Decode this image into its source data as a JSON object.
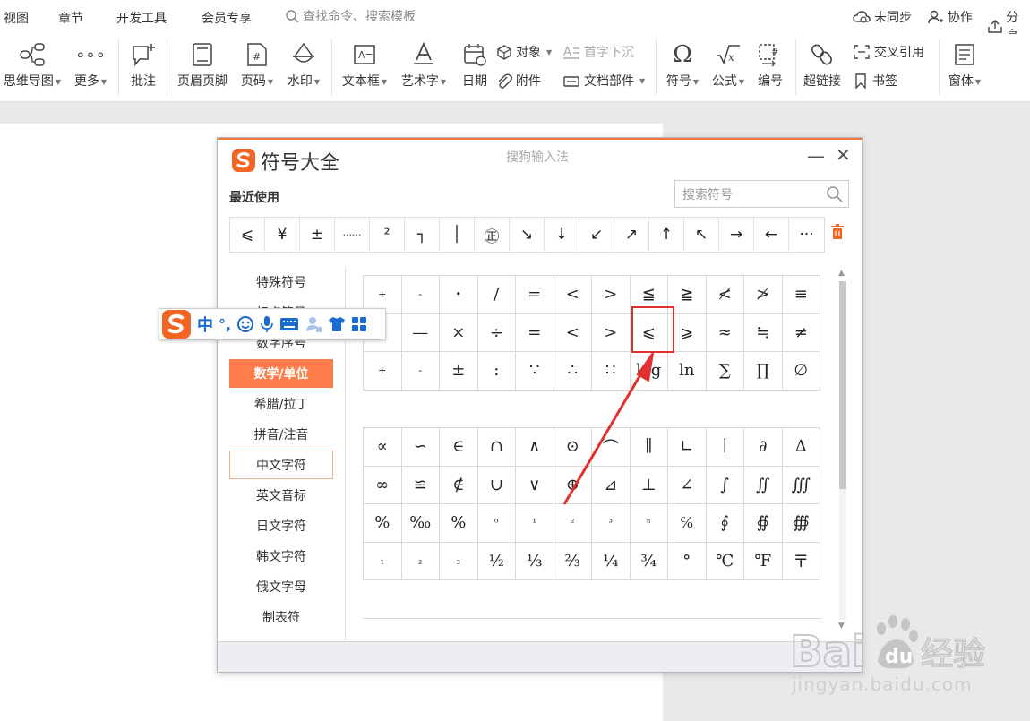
{
  "menubar": {
    "items": [
      "视图",
      "章节",
      "开发工具",
      "会员专享"
    ],
    "search_placeholder": "查找命令、搜索模板",
    "sync": "未同步",
    "collab": "协作",
    "share": "分享"
  },
  "ribbon": {
    "mindmap": "思维导图",
    "more": "更多",
    "comment": "批注",
    "header_footer": "页眉页脚",
    "page_number": "页码",
    "watermark": "水印",
    "textbox": "文本框",
    "wordart": "艺术字",
    "date": "日期",
    "object": "对象",
    "attachment": "附件",
    "drop_cap": "首字下沉",
    "doc_parts": "文档部件",
    "symbol": "符号",
    "formula": "公式",
    "numbering": "编号",
    "hyperlink": "超链接",
    "cross_ref": "交叉引用",
    "bookmark": "书签",
    "window": "窗体"
  },
  "dialog": {
    "title": "符号大全",
    "brand": "搜狗输入法",
    "recent_label": "最近使用",
    "search_placeholder": "搜索符号",
    "recent": [
      "⩽",
      "¥",
      "±",
      "······",
      "²",
      "┐",
      "│",
      "㊣",
      "↘",
      "↓",
      "↙",
      "↗",
      "↑",
      "↖",
      "→",
      "←",
      "···"
    ],
    "categories": [
      "特殊符号",
      "标点符号",
      "数字序号",
      "数学/单位",
      "希腊/拉丁",
      "拼音/注音",
      "中文字符",
      "英文音标",
      "日文字符",
      "韩文字符",
      "俄文字母",
      "制表符"
    ],
    "active_category": "数学/单位",
    "grid1": [
      "+",
      "-",
      "•",
      "/",
      "=",
      "<",
      ">",
      "≦",
      "≧",
      "≮",
      "≯",
      "≡",
      "+",
      "—",
      "×",
      "÷",
      "=",
      "<",
      ">",
      "⩽",
      "⩾",
      "≈",
      "≒",
      "≠",
      "+",
      "-",
      "±",
      ":",
      "∵",
      "∴",
      "∷",
      "log",
      "ln",
      "∑",
      "∏",
      "∅"
    ],
    "grid2": [
      "∝",
      "∽",
      "∈",
      "∩",
      "∧",
      "⊙",
      "⌒",
      "∥",
      "∟",
      "∣",
      "∂",
      "∆",
      "∞",
      "≌",
      "∉",
      "∪",
      "∨",
      "⊕",
      "⊿",
      "⊥",
      "∠",
      "∫",
      "∬",
      "∭",
      "%",
      "‰",
      "%",
      "⁰",
      "¹",
      "²",
      "³",
      "ⁿ",
      "℅",
      "∮",
      "∯",
      "∰",
      "₁",
      "₂",
      "₃",
      "½",
      "⅓",
      "⅔",
      "¼",
      "¾",
      "°",
      "℃",
      "℉",
      "〒"
    ]
  },
  "ime": {
    "mode": "中",
    "punct": "°,"
  },
  "watermark": {
    "site": "jingyan.baidu.com"
  },
  "colors": {
    "accent": "#ff7d4a",
    "ime_blue": "#1a6bd0",
    "annotation_red": "#e23030"
  }
}
